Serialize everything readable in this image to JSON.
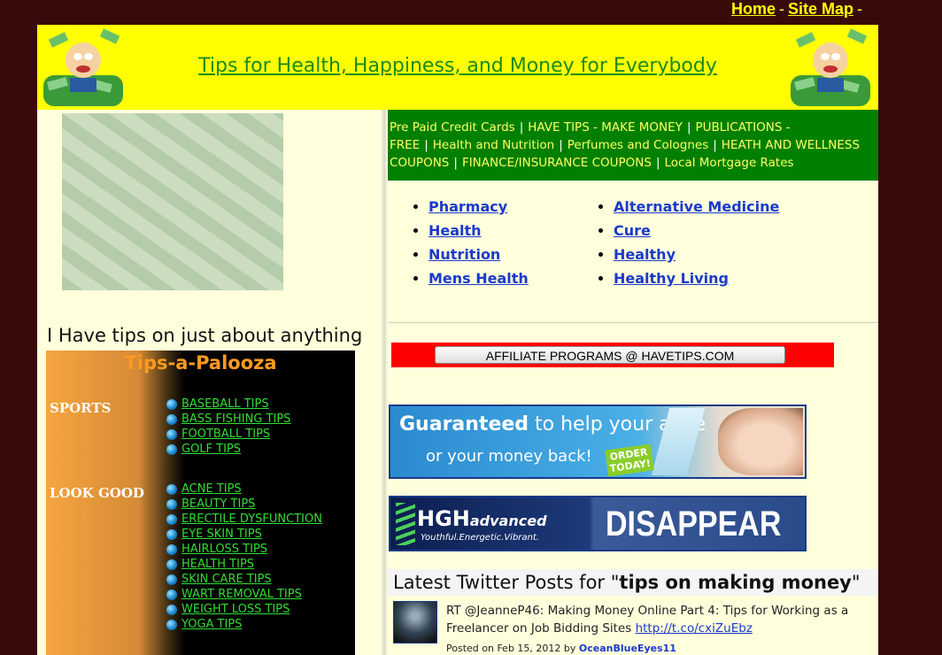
{
  "topnav": {
    "home": "Home",
    "sitemap": "Site Map",
    "sep": "-"
  },
  "header": {
    "title": "Tips for Health, Happiness, and Money for Everybody",
    "bg_color": "#ffff00",
    "title_color": "#1a8a1a"
  },
  "left": {
    "tagline": "I Have tips on just about anything",
    "tips_title": "Tips-a-Palooza",
    "categories": [
      {
        "label": "SPORTS",
        "items": [
          "BASEBALL TIPS",
          "BASS FISHING TIPS",
          "FOOTBALL TIPS",
          "GOLF TIPS"
        ]
      },
      {
        "label": "LOOK GOOD",
        "items": [
          "ACNE TIPS",
          "BEAUTY TIPS",
          "ERECTILE DYSFUNCTION",
          "EYE SKIN TIPS",
          "HAIRLOSS TIPS",
          "HEALTH TIPS",
          "SKIN CARE TIPS",
          "WART REMOVAL TIPS",
          "WEIGHT LOSS TIPS",
          "YOGA TIPS"
        ]
      }
    ]
  },
  "greenbar": {
    "sep": "|",
    "links": [
      "Pre Paid Credit Cards",
      "HAVE TIPS - MAKE MONEY",
      "PUBLICATIONS - FREE",
      "Health and Nutrition",
      "Perfumes and Colognes",
      "HEATH AND WELLNESS COUPONS",
      "FINANCE/INSURANCE COUPONS",
      "Local Mortgage Rates"
    ]
  },
  "health_links": {
    "col1": [
      "Pharmacy",
      "Health",
      "Nutrition",
      "Mens Health"
    ],
    "col2": [
      "Alternative Medicine",
      "Cure",
      "Healthy",
      "Healthy Living"
    ]
  },
  "affiliate": {
    "label": "AFFILIATE PROGRAMS  @ HAVETIPS.COM"
  },
  "ad1": {
    "bold": "Guaranteed",
    "line1_rest": " to help your acne",
    "line2": "or your money back!",
    "order": "ORDER TODAY!"
  },
  "ad2": {
    "brand": "HGH",
    "brand_small": "advanced",
    "slogan": "Youthful.Energetic.Vibrant.",
    "big": "DISAPPEAR"
  },
  "twitter": {
    "heading_prefix": "Latest Twitter Posts for \"",
    "query": "tips on making money",
    "heading_suffix": "\"",
    "tweet_text": "RT @JeanneP46: Making Money Online Part 4: Tips for Working as a Freelancer on Job Bidding Sites ",
    "tweet_link": "http://t.co/cxiZuEbz",
    "posted": "Posted on Feb 15, 2012 by ",
    "author": "OceanBlueEyes11"
  }
}
